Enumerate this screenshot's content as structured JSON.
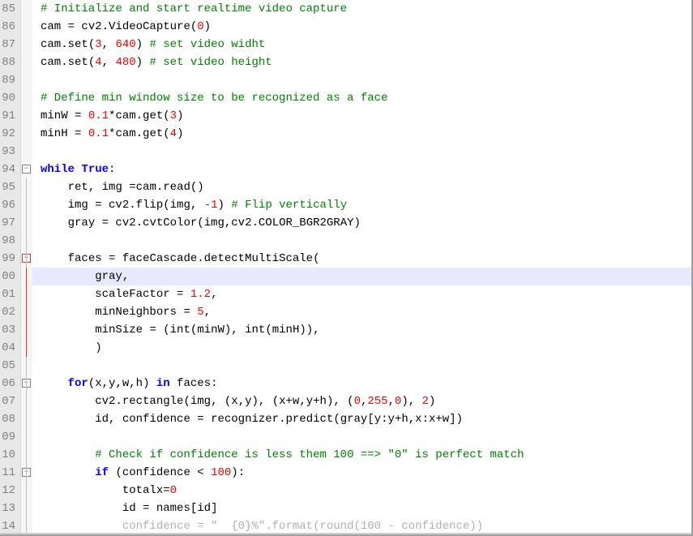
{
  "lines": [
    {
      "n": "85",
      "fold": null,
      "seg": [
        {
          "c": "tok-cmt",
          "t": "# Initialize and start realtime video capture"
        }
      ],
      "indent": 0
    },
    {
      "n": "86",
      "fold": null,
      "seg": [
        {
          "c": "tok-id",
          "t": "cam "
        },
        {
          "c": "tok-op",
          "t": "="
        },
        {
          "c": "tok-id",
          "t": " cv2.VideoCapture"
        },
        {
          "c": "tok-op",
          "t": "("
        },
        {
          "c": "tok-num",
          "t": "0"
        },
        {
          "c": "tok-op",
          "t": ")"
        }
      ],
      "indent": 0
    },
    {
      "n": "87",
      "fold": null,
      "seg": [
        {
          "c": "tok-id",
          "t": "cam.set"
        },
        {
          "c": "tok-op",
          "t": "("
        },
        {
          "c": "tok-num",
          "t": "3"
        },
        {
          "c": "tok-op",
          "t": ", "
        },
        {
          "c": "tok-num",
          "t": "640"
        },
        {
          "c": "tok-op",
          "t": ") "
        },
        {
          "c": "tok-cmt",
          "t": "# set video widht"
        }
      ],
      "indent": 0
    },
    {
      "n": "88",
      "fold": null,
      "seg": [
        {
          "c": "tok-id",
          "t": "cam.set"
        },
        {
          "c": "tok-op",
          "t": "("
        },
        {
          "c": "tok-num",
          "t": "4"
        },
        {
          "c": "tok-op",
          "t": ", "
        },
        {
          "c": "tok-num",
          "t": "480"
        },
        {
          "c": "tok-op",
          "t": ") "
        },
        {
          "c": "tok-cmt",
          "t": "# set video height"
        }
      ],
      "indent": 0
    },
    {
      "n": "89",
      "fold": null,
      "seg": [],
      "indent": 0
    },
    {
      "n": "90",
      "fold": null,
      "seg": [
        {
          "c": "tok-cmt",
          "t": "# Define min window size to be recognized as a face"
        }
      ],
      "indent": 0
    },
    {
      "n": "91",
      "fold": null,
      "seg": [
        {
          "c": "tok-id",
          "t": "minW "
        },
        {
          "c": "tok-op",
          "t": "="
        },
        {
          "c": "tok-id",
          "t": " "
        },
        {
          "c": "tok-num",
          "t": "0.1"
        },
        {
          "c": "tok-op",
          "t": "*"
        },
        {
          "c": "tok-id",
          "t": "cam.get"
        },
        {
          "c": "tok-op",
          "t": "("
        },
        {
          "c": "tok-num",
          "t": "3"
        },
        {
          "c": "tok-op",
          "t": ")"
        }
      ],
      "indent": 0
    },
    {
      "n": "92",
      "fold": null,
      "seg": [
        {
          "c": "tok-id",
          "t": "minH "
        },
        {
          "c": "tok-op",
          "t": "="
        },
        {
          "c": "tok-id",
          "t": " "
        },
        {
          "c": "tok-num",
          "t": "0.1"
        },
        {
          "c": "tok-op",
          "t": "*"
        },
        {
          "c": "tok-id",
          "t": "cam.get"
        },
        {
          "c": "tok-op",
          "t": "("
        },
        {
          "c": "tok-num",
          "t": "4"
        },
        {
          "c": "tok-op",
          "t": ")"
        }
      ],
      "indent": 0
    },
    {
      "n": "93",
      "fold": null,
      "seg": [],
      "indent": 0
    },
    {
      "n": "94",
      "fold": "minus",
      "seg": [
        {
          "c": "tok-kw",
          "t": "while"
        },
        {
          "c": "tok-op",
          "t": " "
        },
        {
          "c": "tok-kw",
          "t": "True"
        },
        {
          "c": "tok-op",
          "t": ":"
        }
      ],
      "indent": -1
    },
    {
      "n": "95",
      "fold": null,
      "seg": [
        {
          "c": "tok-id",
          "t": "ret"
        },
        {
          "c": "tok-op",
          "t": ", "
        },
        {
          "c": "tok-id",
          "t": "img "
        },
        {
          "c": "tok-op",
          "t": "="
        },
        {
          "c": "tok-id",
          "t": "cam.read"
        },
        {
          "c": "tok-op",
          "t": "()"
        }
      ],
      "indent": 1
    },
    {
      "n": "96",
      "fold": null,
      "seg": [
        {
          "c": "tok-id",
          "t": "img "
        },
        {
          "c": "tok-op",
          "t": "="
        },
        {
          "c": "tok-id",
          "t": " cv2.flip"
        },
        {
          "c": "tok-op",
          "t": "("
        },
        {
          "c": "tok-id",
          "t": "img"
        },
        {
          "c": "tok-op",
          "t": ", "
        },
        {
          "c": "tok-num",
          "t": "-1"
        },
        {
          "c": "tok-op",
          "t": ") "
        },
        {
          "c": "tok-cmt",
          "t": "# Flip vertically"
        }
      ],
      "indent": 1
    },
    {
      "n": "97",
      "fold": null,
      "seg": [
        {
          "c": "tok-id",
          "t": "gray "
        },
        {
          "c": "tok-op",
          "t": "="
        },
        {
          "c": "tok-id",
          "t": " cv2.cvtColor"
        },
        {
          "c": "tok-op",
          "t": "("
        },
        {
          "c": "tok-id",
          "t": "img"
        },
        {
          "c": "tok-op",
          "t": ","
        },
        {
          "c": "tok-id",
          "t": "cv2.COLOR_BGR2GRAY"
        },
        {
          "c": "tok-op",
          "t": ")"
        }
      ],
      "indent": 1
    },
    {
      "n": "98",
      "fold": null,
      "seg": [],
      "indent": 1
    },
    {
      "n": "99",
      "fold": "minus-red",
      "seg": [
        {
          "c": "tok-id",
          "t": "faces "
        },
        {
          "c": "tok-op",
          "t": "="
        },
        {
          "c": "tok-id",
          "t": " faceCascade.detectMultiScale"
        },
        {
          "c": "tok-op",
          "t": "("
        }
      ],
      "indent": 1
    },
    {
      "n": "00",
      "fold": null,
      "hl": true,
      "seg": [
        {
          "c": "tok-id",
          "t": "gray"
        },
        {
          "c": "tok-op",
          "t": ","
        }
      ],
      "indent": 2
    },
    {
      "n": "01",
      "fold": null,
      "seg": [
        {
          "c": "tok-id",
          "t": "scaleFactor "
        },
        {
          "c": "tok-op",
          "t": "="
        },
        {
          "c": "tok-id",
          "t": " "
        },
        {
          "c": "tok-num",
          "t": "1.2"
        },
        {
          "c": "tok-op",
          "t": ","
        }
      ],
      "indent": 2
    },
    {
      "n": "02",
      "fold": null,
      "seg": [
        {
          "c": "tok-id",
          "t": "minNeighbors "
        },
        {
          "c": "tok-op",
          "t": "="
        },
        {
          "c": "tok-id",
          "t": " "
        },
        {
          "c": "tok-num",
          "t": "5"
        },
        {
          "c": "tok-op",
          "t": ","
        }
      ],
      "indent": 2
    },
    {
      "n": "03",
      "fold": null,
      "seg": [
        {
          "c": "tok-id",
          "t": "minSize "
        },
        {
          "c": "tok-op",
          "t": "="
        },
        {
          "c": "tok-id",
          "t": " "
        },
        {
          "c": "tok-op",
          "t": "("
        },
        {
          "c": "tok-builtin",
          "t": "int"
        },
        {
          "c": "tok-op",
          "t": "("
        },
        {
          "c": "tok-id",
          "t": "minW"
        },
        {
          "c": "tok-op",
          "t": "), "
        },
        {
          "c": "tok-builtin",
          "t": "int"
        },
        {
          "c": "tok-op",
          "t": "("
        },
        {
          "c": "tok-id",
          "t": "minH"
        },
        {
          "c": "tok-op",
          "t": ")),"
        }
      ],
      "indent": 2
    },
    {
      "n": "04",
      "fold": null,
      "seg": [
        {
          "c": "tok-op",
          "t": ")"
        }
      ],
      "indent": 2,
      "endred": true
    },
    {
      "n": "05",
      "fold": null,
      "seg": [],
      "indent": 1
    },
    {
      "n": "06",
      "fold": "minus",
      "seg": [
        {
          "c": "tok-kw",
          "t": "for"
        },
        {
          "c": "tok-op",
          "t": "("
        },
        {
          "c": "tok-id",
          "t": "x"
        },
        {
          "c": "tok-op",
          "t": ","
        },
        {
          "c": "tok-id",
          "t": "y"
        },
        {
          "c": "tok-op",
          "t": ","
        },
        {
          "c": "tok-id",
          "t": "w"
        },
        {
          "c": "tok-op",
          "t": ","
        },
        {
          "c": "tok-id",
          "t": "h"
        },
        {
          "c": "tok-op",
          "t": ") "
        },
        {
          "c": "tok-kw",
          "t": "in"
        },
        {
          "c": "tok-id",
          "t": " faces"
        },
        {
          "c": "tok-op",
          "t": ":"
        }
      ],
      "indent": 1
    },
    {
      "n": "07",
      "fold": null,
      "seg": [
        {
          "c": "tok-id",
          "t": "cv2.rectangle"
        },
        {
          "c": "tok-op",
          "t": "("
        },
        {
          "c": "tok-id",
          "t": "img"
        },
        {
          "c": "tok-op",
          "t": ", ("
        },
        {
          "c": "tok-id",
          "t": "x"
        },
        {
          "c": "tok-op",
          "t": ","
        },
        {
          "c": "tok-id",
          "t": "y"
        },
        {
          "c": "tok-op",
          "t": "), ("
        },
        {
          "c": "tok-id",
          "t": "x"
        },
        {
          "c": "tok-op",
          "t": "+"
        },
        {
          "c": "tok-id",
          "t": "w"
        },
        {
          "c": "tok-op",
          "t": ","
        },
        {
          "c": "tok-id",
          "t": "y"
        },
        {
          "c": "tok-op",
          "t": "+"
        },
        {
          "c": "tok-id",
          "t": "h"
        },
        {
          "c": "tok-op",
          "t": "), ("
        },
        {
          "c": "tok-num",
          "t": "0"
        },
        {
          "c": "tok-op",
          "t": ","
        },
        {
          "c": "tok-num",
          "t": "255"
        },
        {
          "c": "tok-op",
          "t": ","
        },
        {
          "c": "tok-num",
          "t": "0"
        },
        {
          "c": "tok-op",
          "t": "), "
        },
        {
          "c": "tok-num",
          "t": "2"
        },
        {
          "c": "tok-op",
          "t": ")"
        }
      ],
      "indent": 2
    },
    {
      "n": "08",
      "fold": null,
      "seg": [
        {
          "c": "tok-id",
          "t": "id"
        },
        {
          "c": "tok-op",
          "t": ", "
        },
        {
          "c": "tok-id",
          "t": "confidence "
        },
        {
          "c": "tok-op",
          "t": "="
        },
        {
          "c": "tok-id",
          "t": " recognizer.predict"
        },
        {
          "c": "tok-op",
          "t": "("
        },
        {
          "c": "tok-id",
          "t": "gray"
        },
        {
          "c": "tok-op",
          "t": "["
        },
        {
          "c": "tok-id",
          "t": "y"
        },
        {
          "c": "tok-op",
          "t": ":"
        },
        {
          "c": "tok-id",
          "t": "y"
        },
        {
          "c": "tok-op",
          "t": "+"
        },
        {
          "c": "tok-id",
          "t": "h"
        },
        {
          "c": "tok-op",
          "t": ","
        },
        {
          "c": "tok-id",
          "t": "x"
        },
        {
          "c": "tok-op",
          "t": ":"
        },
        {
          "c": "tok-id",
          "t": "x"
        },
        {
          "c": "tok-op",
          "t": "+"
        },
        {
          "c": "tok-id",
          "t": "w"
        },
        {
          "c": "tok-op",
          "t": "])"
        }
      ],
      "indent": 2
    },
    {
      "n": "09",
      "fold": null,
      "seg": [],
      "indent": 2
    },
    {
      "n": "10",
      "fold": null,
      "seg": [
        {
          "c": "tok-cmt",
          "t": "# Check if confidence is less them 100 ==> \"0\" is perfect match"
        }
      ],
      "indent": 2
    },
    {
      "n": "11",
      "fold": "minus",
      "seg": [
        {
          "c": "tok-kw",
          "t": "if"
        },
        {
          "c": "tok-id",
          "t": " "
        },
        {
          "c": "tok-op",
          "t": "("
        },
        {
          "c": "tok-id",
          "t": "confidence "
        },
        {
          "c": "tok-op",
          "t": "<"
        },
        {
          "c": "tok-id",
          "t": " "
        },
        {
          "c": "tok-num",
          "t": "100"
        },
        {
          "c": "tok-op",
          "t": "):"
        }
      ],
      "indent": 2
    },
    {
      "n": "12",
      "fold": null,
      "seg": [
        {
          "c": "tok-id",
          "t": "totalx"
        },
        {
          "c": "tok-op",
          "t": "="
        },
        {
          "c": "tok-num",
          "t": "0"
        }
      ],
      "indent": 3
    },
    {
      "n": "13",
      "fold": null,
      "seg": [
        {
          "c": "tok-id",
          "t": "id "
        },
        {
          "c": "tok-op",
          "t": "="
        },
        {
          "c": "tok-id",
          "t": " names"
        },
        {
          "c": "tok-op",
          "t": "["
        },
        {
          "c": "tok-id",
          "t": "id"
        },
        {
          "c": "tok-op",
          "t": "]"
        }
      ],
      "indent": 3
    },
    {
      "n": "14",
      "fold": null,
      "seg": [
        {
          "c": "cut",
          "t": "confidence = \"  {0}%\".format(round(100 - confidence))"
        }
      ],
      "indent": 3,
      "cut": true
    }
  ],
  "indentUnit": "    "
}
